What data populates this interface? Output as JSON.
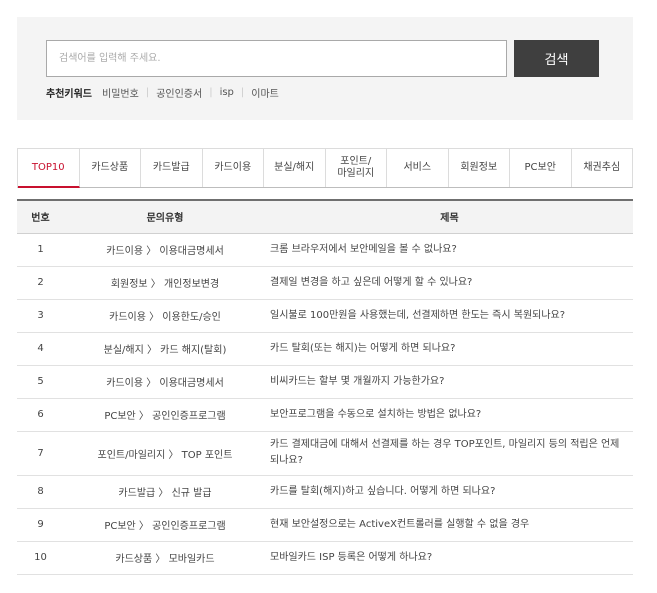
{
  "search": {
    "placeholder": "검색어를 입력해 주세요.",
    "button_label": "검색",
    "recommended_title": "추천키워드",
    "keywords": [
      "비밀번호",
      "공인인증서",
      "isp",
      "이마트"
    ]
  },
  "tabs": [
    "TOP10",
    "카드상품",
    "카드발급",
    "카드이용",
    "분실/해지",
    "포인트/\n마일리지",
    "서비스",
    "회원정보",
    "PC보안",
    "채권추심"
  ],
  "active_tab": "TOP10",
  "table": {
    "headers": {
      "no": "번호",
      "category": "문의유형",
      "title": "제목"
    },
    "rows": [
      {
        "no": "1",
        "category": "카드이용 〉 이용대금명세서",
        "title": "크롬 브라우저에서 보안메일을 볼 수 없나요?"
      },
      {
        "no": "2",
        "category": "회원정보 〉 개인정보변경",
        "title": "결제일 변경을 하고 싶은데 어떻게 할 수 있나요?"
      },
      {
        "no": "3",
        "category": "카드이용 〉 이용한도/승인",
        "title": "일시불로 100만원을 사용했는데, 선결제하면 한도는 즉시 복원되나요?"
      },
      {
        "no": "4",
        "category": "분실/해지 〉 카드 해지(탈회)",
        "title": "카드 탈회(또는 해지)는 어떻게 하면 되나요?"
      },
      {
        "no": "5",
        "category": "카드이용 〉 이용대금명세서",
        "title": "비씨카드는 할부 몇 개월까지 가능한가요?"
      },
      {
        "no": "6",
        "category": "PC보안 〉 공인인증프로그램",
        "title": "보안프로그램을 수동으로 설치하는 방법은 없나요?"
      },
      {
        "no": "7",
        "category": "포인트/마일리지 〉 TOP 포인트",
        "title": "카드 결제대금에 대해서 선결제를 하는 경우 TOP포인트, 마일리지 등의 적립은 언제 되나요?"
      },
      {
        "no": "8",
        "category": "카드발급 〉 신규 발급",
        "title": "카드를 탈회(해지)하고 싶습니다. 어떻게 하면 되나요?"
      },
      {
        "no": "9",
        "category": "PC보안 〉 공인인증프로그램",
        "title": "현재 보안설정으로는 ActiveX컨트롤러를 실행할 수 없을 경우"
      },
      {
        "no": "10",
        "category": "카드상품 〉 모바일카드",
        "title": "모바일카드 ISP 등록은 어떻게 하나요?"
      }
    ]
  },
  "colors": {
    "accent": "#c8102e",
    "button_bg": "#3f3f3f",
    "panel_bg": "#f4f4f4"
  }
}
